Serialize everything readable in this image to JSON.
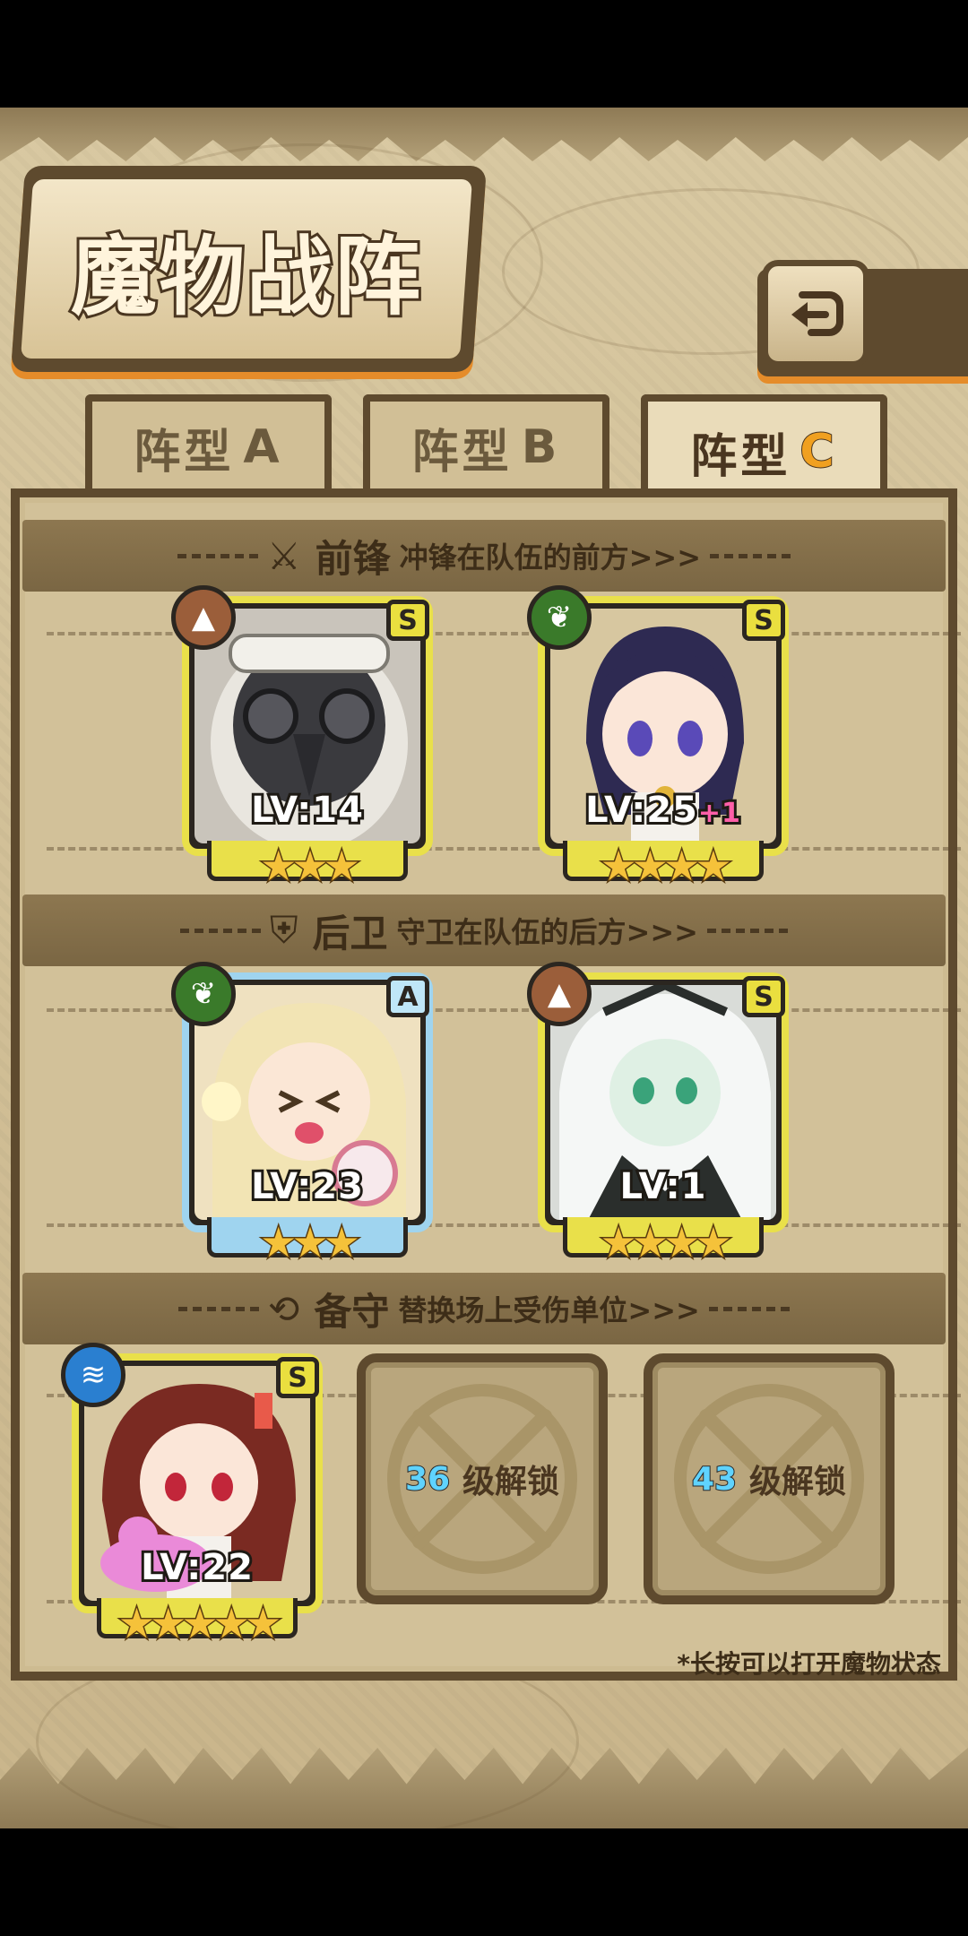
{
  "title": "魔物战阵",
  "back_icon": "return-arrow-icon",
  "tabs": [
    {
      "label": "阵型",
      "letter": "A",
      "active": false
    },
    {
      "label": "阵型",
      "letter": "B",
      "active": false
    },
    {
      "label": "阵型",
      "letter": "C",
      "active": true
    }
  ],
  "sections": {
    "front": {
      "title": "前锋",
      "subtitle": "冲锋在队伍的前方>>>",
      "icon": "sword-icon"
    },
    "rear": {
      "title": "后卫",
      "subtitle": "守卫在队伍的后方>>>",
      "icon": "shield-icon"
    },
    "reserve": {
      "title": "备守",
      "subtitle": "替换场上受伤单位>>>",
      "icon": "swap-icon"
    }
  },
  "monsters": {
    "front_1": {
      "level": "LV:14",
      "rank": "S",
      "stars": 3,
      "element": "earth"
    },
    "front_2": {
      "level": "LV:25",
      "bonus": "+1",
      "rank": "S",
      "stars": 4,
      "element": "nature"
    },
    "rear_1": {
      "level": "LV:23",
      "rank": "A",
      "stars": 3,
      "element": "nature"
    },
    "rear_2": {
      "level": "LV:1",
      "rank": "S",
      "stars": 4,
      "element": "earth"
    },
    "reserve_1": {
      "level": "LV:22",
      "rank": "S",
      "stars": 5,
      "element": "water"
    }
  },
  "locked_slots": [
    {
      "level": "36",
      "text": "级解锁"
    },
    {
      "level": "43",
      "text": "级解锁"
    }
  ],
  "footnote": "*长按可以打开魔物状态",
  "stars_3": "★★★",
  "stars_4": "★★★★",
  "stars_5": "★★★★★",
  "colors": {
    "accent": "#e58c2a",
    "frame": "#5e4a2e",
    "card_s": "#e9e04a",
    "card_a": "#9fd4ef"
  }
}
